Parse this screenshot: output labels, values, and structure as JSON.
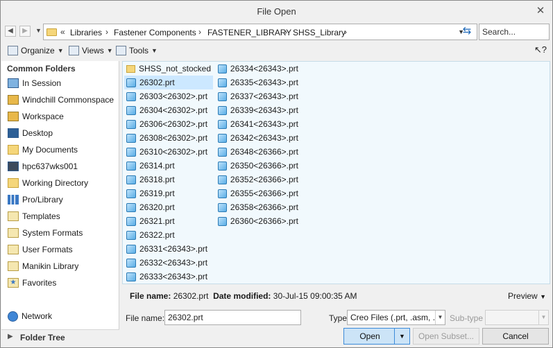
{
  "window": {
    "title": "File Open"
  },
  "nav": {
    "path": [
      "Libraries",
      "Fastener Components",
      "FASTENER_LIBRARY",
      "SHSS_Library"
    ],
    "search_placeholder": "Search..."
  },
  "toolbar": {
    "organize_label": "Organize",
    "views_label": "Views",
    "tools_label": "Tools"
  },
  "sidebar": {
    "heading": "Common Folders",
    "items": [
      {
        "label": "In Session",
        "icon": "monitor-icon"
      },
      {
        "label": "Windchill Commonspace",
        "icon": "commonspace-icon"
      },
      {
        "label": "Workspace",
        "icon": "workspace-icon"
      },
      {
        "label": "Desktop",
        "icon": "desktop-icon"
      },
      {
        "label": "My Documents",
        "icon": "documents-icon"
      },
      {
        "label": "hpc637wks001",
        "icon": "computer-icon"
      },
      {
        "label": "Working Directory",
        "icon": "working-directory-icon"
      },
      {
        "label": "Pro/Library",
        "icon": "library-icon"
      },
      {
        "label": "Templates",
        "icon": "templates-icon"
      },
      {
        "label": "System Formats",
        "icon": "system-formats-icon"
      },
      {
        "label": "User Formats",
        "icon": "user-formats-icon"
      },
      {
        "label": "Manikin Library",
        "icon": "manikin-icon"
      },
      {
        "label": "Favorites",
        "icon": "favorites-icon"
      }
    ],
    "network_label": "Network",
    "folder_tree_label": "Folder Tree"
  },
  "files": {
    "col1": [
      "SHSS_not_stocked",
      "26302.prt",
      "26303<26302>.prt",
      "26304<26302>.prt",
      "26306<26302>.prt",
      "26308<26302>.prt",
      "26310<26302>.prt",
      "26314.prt",
      "26318.prt",
      "26319.prt",
      "26320.prt",
      "26321.prt",
      "26322.prt",
      "26331<26343>.prt",
      "26332<26343>.prt",
      "26333<26343>.prt"
    ],
    "col2": [
      "26334<26343>.prt",
      "26335<26343>.prt",
      "26337<26343>.prt",
      "26339<26343>.prt",
      "26341<26343>.prt",
      "26342<26343>.prt",
      "26348<26366>.prt",
      "26350<26366>.prt",
      "26352<26366>.prt",
      "26355<26366>.prt",
      "26358<26366>.prt",
      "26360<26366>.prt"
    ],
    "selected": "26302.prt"
  },
  "info": {
    "file_name_label": "File name:",
    "file_name_value": "26302.prt",
    "date_label": "Date modified:",
    "date_value": "30-Jul-15 09:00:35 AM",
    "preview_label": "Preview"
  },
  "form": {
    "file_name_label": "File name:",
    "file_name_value": "26302.prt",
    "type_label": "Type",
    "type_value": "Creo Files (.prt, .asm, .",
    "subtype_label": "Sub-type",
    "open_label": "Open",
    "open_subset_label": "Open Subset...",
    "cancel_label": "Cancel"
  }
}
